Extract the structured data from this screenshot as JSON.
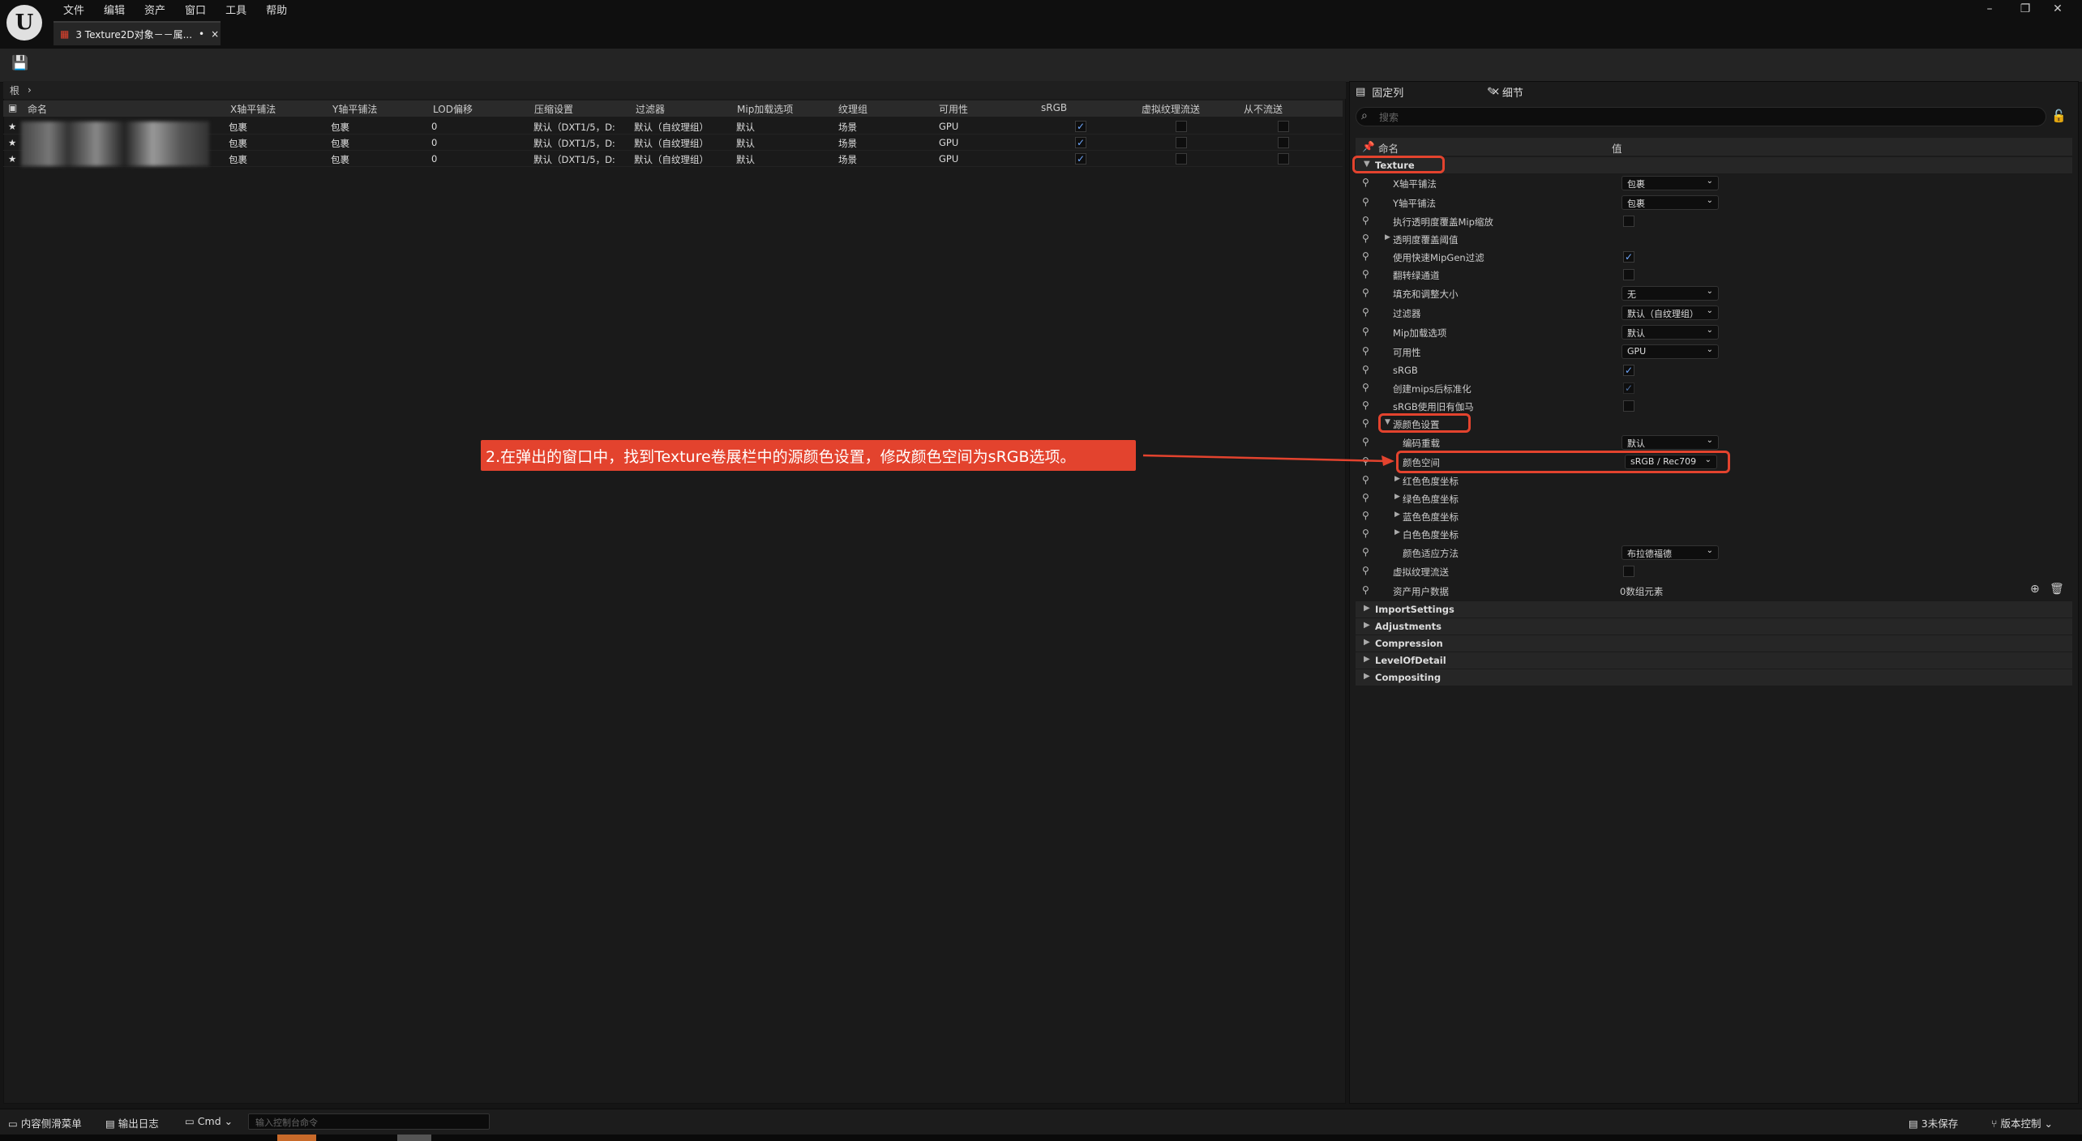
{
  "menu": [
    "文件",
    "编辑",
    "资产",
    "窗口",
    "工具",
    "帮助"
  ],
  "doc_tab": {
    "title": "3 Texture2D对象－－属...",
    "modified": "•",
    "close": "×"
  },
  "window_controls": {
    "minimize": "–",
    "restore": "❐",
    "close": "✕"
  },
  "breadcrumb": {
    "root": "根",
    "sep": "›"
  },
  "table": {
    "columns": [
      "命名",
      "X轴平铺法",
      "Y轴平铺法",
      "LOD偏移",
      "压缩设置",
      "过滤器",
      "Mip加载选项",
      "纹理组",
      "可用性",
      "sRGB",
      "虚拟纹理流送",
      "从不流送"
    ],
    "rows": [
      {
        "star": "★",
        "x": "包裹",
        "y": "包裹",
        "lod": "0",
        "comp": "默认（DXT1/5，D:",
        "filter": "默认（自纹理组）",
        "mip": "默认",
        "group": "场景",
        "avail": "GPU",
        "srgb": true,
        "vt": false,
        "never": false
      },
      {
        "star": "★",
        "x": "包裹",
        "y": "包裹",
        "lod": "0",
        "comp": "默认（DXT1/5，D:",
        "filter": "默认（自纹理组）",
        "mip": "默认",
        "group": "场景",
        "avail": "GPU",
        "srgb": true,
        "vt": false,
        "never": false
      },
      {
        "star": "★",
        "x": "包裹",
        "y": "包裹",
        "lod": "0",
        "comp": "默认（DXT1/5，D:",
        "filter": "默认（自纹理组）",
        "mip": "默认",
        "group": "场景",
        "avail": "GPU",
        "srgb": true,
        "vt": false,
        "never": false
      }
    ]
  },
  "right_tabs": {
    "pinned": "固定列",
    "details": "细节",
    "close": "×"
  },
  "search": {
    "placeholder": "搜索"
  },
  "prop_header": {
    "name": "命名",
    "value": "值"
  },
  "texture_section": "Texture",
  "props": {
    "x_tiling": {
      "label": "X轴平铺法",
      "value": "包裹"
    },
    "y_tiling": {
      "label": "Y轴平铺法",
      "value": "包裹"
    },
    "alpha_coverage": {
      "label": "执行透明度覆盖Mip缩放"
    },
    "alpha_threshold": {
      "label": "透明度覆盖阈值"
    },
    "fast_mipgen": {
      "label": "使用快速MipGen过滤"
    },
    "flip_green": {
      "label": "翻转绿通道"
    },
    "pad_resize": {
      "label": "填充和调整大小",
      "value": "无"
    },
    "filter": {
      "label": "过滤器",
      "value": "默认（自纹理组）"
    },
    "mip_load": {
      "label": "Mip加载选项",
      "value": "默认"
    },
    "availability": {
      "label": "可用性",
      "value": "GPU"
    },
    "srgb": {
      "label": "sRGB"
    },
    "normalize_mips": {
      "label": "创建mips后标准化"
    },
    "legacy_gamma": {
      "label": "sRGB使用旧有伽马"
    },
    "source_color": {
      "label": "源颜色设置"
    },
    "encoding": {
      "label": "编码重载",
      "value": "默认"
    },
    "color_space": {
      "label": "颜色空间",
      "value": "sRGB / Rec709"
    },
    "red": {
      "label": "红色色度坐标"
    },
    "green": {
      "label": "绿色色度坐标"
    },
    "blue": {
      "label": "蓝色色度坐标"
    },
    "white": {
      "label": "白色色度坐标"
    },
    "adapt": {
      "label": "颜色适应方法",
      "value": "布拉德福德"
    },
    "vt_stream": {
      "label": "虚拟纹理流送"
    },
    "user_data": {
      "label": "资产用户数据",
      "value": "0数组元素"
    }
  },
  "sections": [
    "ImportSettings",
    "Adjustments",
    "Compression",
    "LevelOfDetail",
    "Compositing"
  ],
  "annotation": "2.在弹出的窗口中，找到Texture卷展栏中的源颜色设置，修改颜色空间为sRGB选项。",
  "status": {
    "content_drawer": "内容侧滑菜单",
    "output_log": "输出日志",
    "cmd": "Cmd",
    "cmd_placeholder": "输入控制台命令",
    "unsaved": "3未保存",
    "source_control": "版本控制"
  },
  "colors": {
    "accent": "#e3432e",
    "check": "#6fa8ff"
  }
}
